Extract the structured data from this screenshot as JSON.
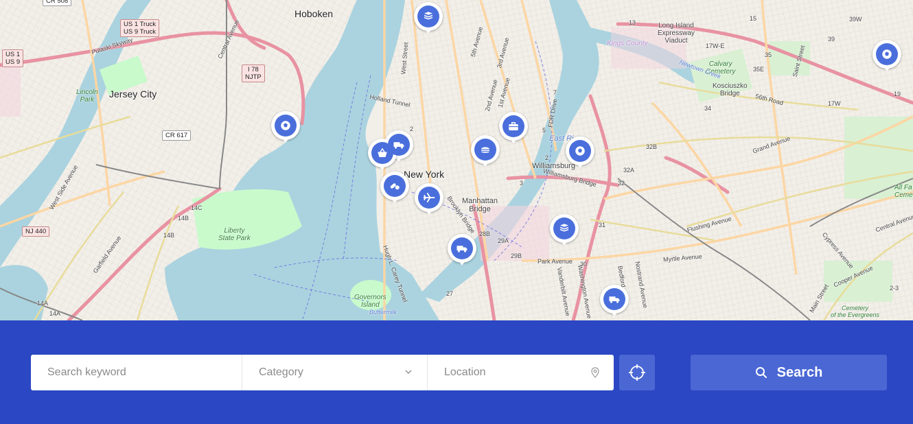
{
  "map": {
    "labels": {
      "hoboken": "Hoboken",
      "jersey_city": "Jersey City",
      "new_york": "New York",
      "manhattan_bridge": "Manhattan\nBridge",
      "williamsburg": "Williamsburg",
      "long_island_expressway": "Long Island\nExpressway\nViaduct",
      "kosciuszko_bridge": "Kosciuszko\nBridge",
      "kings_county": "Kings County",
      "liberty_state_park": "Liberty\nState Park",
      "lincoln_park": "Lincoln\nPark",
      "calvary_cemetery": "Calvary\nCemetery",
      "governors_island": "Governors\nIsland",
      "cemetery_evergreens": "Cemetery\nof the Evergreens",
      "all_faiths": "All Fa\nCeme",
      "east_river": "East Ri",
      "holland_tunnel": "Holland Tunnel",
      "pulaski_skyway": "Pulaski Skyway",
      "west_side_avenue": "West Side Avenue",
      "garfield_avenue": "Garfield Avenue",
      "central_avenue": "Central Avenue",
      "grand_avenue": "Grand Avenue",
      "flushing_avenue": "Flushing Avenue",
      "myrtle_avenue": "Myrtle Avenue",
      "park_avenue": "Park Avenue",
      "cooper_avenue": "Cooper Avenue",
      "cypress_avenue": "Cypress Avenue",
      "fdr_drive": "FDR Drive",
      "west_street": "West Street",
      "brooklyn_bridge": "Brooklyn Bridge",
      "williamsburg_bridge": "Williamsburg Bridge",
      "hugh_carey_tunnel": "Hugh L. Carey Tunnel",
      "first_avenue": "1st Avenue",
      "second_avenue": "2nd Avenue",
      "third_avenue": "3rd Avenue",
      "fifth_avenue": "5th Avenue",
      "vanderbilt_avenue": "Vanderbilt Avenue",
      "washington_avenue": "Washington Avenue",
      "nostrand_avenue": "Nostrand Avenue",
      "bedford": "Bedford",
      "buttermilk": "Buttermilk",
      "newtown_creek": "Newtown Creek",
      "main_street": "Main Street",
      "saint_street": "Saint Street",
      "fifty_sixth_road": "56th Road"
    },
    "shields": {
      "us1_truck": "US 1 Truck\nUS 9 Truck",
      "us1": "US 1\nUS 9",
      "i78": "I 78\nNJTP",
      "cr617": "CR 617",
      "nj440": "NJ 440",
      "cr508": "CR 508"
    },
    "route_numbers": [
      "14C",
      "14B",
      "14B",
      "14A",
      "14A",
      "2",
      "5",
      "7",
      "3",
      "2",
      "28B",
      "29A",
      "29B",
      "27",
      "30",
      "31",
      "32",
      "32A",
      "32B",
      "34",
      "35",
      "35E",
      "17W-E",
      "17W",
      "13",
      "15",
      "39",
      "39W",
      "2-3",
      "19"
    ],
    "markers": [
      {
        "icon": "book-icon"
      },
      {
        "icon": "soccer-icon"
      },
      {
        "icon": "soccer-icon"
      },
      {
        "icon": "truck-icon"
      },
      {
        "icon": "basket-icon"
      },
      {
        "icon": "pills-icon"
      },
      {
        "icon": "airplane-icon"
      },
      {
        "icon": "burger-icon"
      },
      {
        "icon": "briefcase-icon"
      },
      {
        "icon": "soccer-icon"
      },
      {
        "icon": "book-icon"
      },
      {
        "icon": "truck-icon"
      },
      {
        "icon": "truck-icon"
      }
    ],
    "colors": {
      "water": "#aad3df",
      "park": "#c8facc",
      "motorway": "#e892a2",
      "primary": "#fcd6a4",
      "secondary": "#f7fabf",
      "marker": "#4a6fdc"
    }
  },
  "search": {
    "keyword_placeholder": "Search keyword",
    "category_label": "Category",
    "location_placeholder": "Location",
    "search_label": "Search",
    "colors": {
      "bar_bg": "#2b47c3",
      "button_bg": "#4a67d4"
    }
  }
}
